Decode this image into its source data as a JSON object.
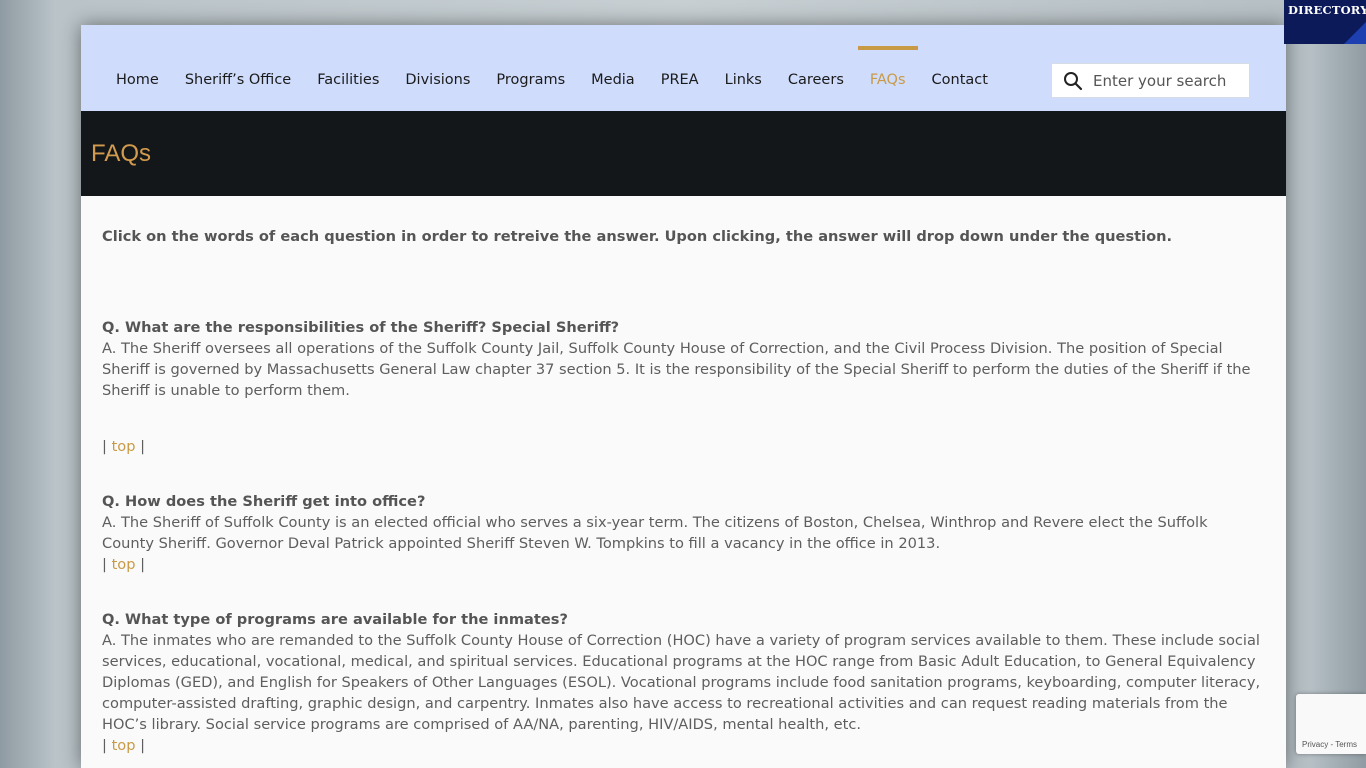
{
  "nav": {
    "items": [
      {
        "label": "Home"
      },
      {
        "label": "Sheriff’s Office"
      },
      {
        "label": "Facilities"
      },
      {
        "label": "Divisions"
      },
      {
        "label": "Programs"
      },
      {
        "label": "Media"
      },
      {
        "label": "PREA"
      },
      {
        "label": "Links"
      },
      {
        "label": "Careers"
      },
      {
        "label": "FAQs"
      },
      {
        "label": "Contact"
      }
    ],
    "active": "FAQs"
  },
  "search": {
    "placeholder": "Enter your search",
    "icon": "search-icon"
  },
  "page_title": "FAQs",
  "intro": "Click on the words of each question in order to retreive the answer. Upon clicking, the answer will drop down under the question.",
  "faqs": [
    {
      "question": "Q. What are the responsibilities of the Sheriff? Special Sheriff?",
      "answer": "A. The Sheriff oversees all operations of the Suffolk County Jail, Suffolk County House of Correction, and the Civil Process Division. The position of Special Sheriff is governed by Massachusetts General Law chapter 37 section 5. It is the responsibility of the Special Sheriff to perform the duties of the Sheriff if the Sheriff is unable to perform them.",
      "top_label": "top"
    },
    {
      "question": "Q. How does the Sheriff get into office?",
      "answer": "A. The Sheriff of Suffolk County is an elected official who serves a six-year term. The citizens of Boston, Chelsea, Winthrop and Revere elect the Suffolk County Sheriff. Governor Deval Patrick appointed Sheriff Steven W. Tompkins to fill a vacancy in the office in 2013.",
      "top_label": "top"
    },
    {
      "question": "Q. What type of programs are available for the inmates?",
      "answer": "A. The inmates who are remanded to the Suffolk County House of Correction (HOC) have a variety of program services available to them. These include social services, educational, vocational, medical, and spiritual services. Educational programs at the HOC range from Basic Adult Education, to General Equivalency Diplomas (GED), and English for Speakers of Other Languages (ESOL). Vocational programs include food sanitation programs, keyboarding, computer literacy, computer-assisted drafting, graphic design, and carpentry. Inmates also have access to recreational activities and can request reading materials from the HOC’s library. Social service programs are comprised of AA/NA, parenting, HIV/AIDS, mental health, etc.",
      "top_label": "top"
    }
  ],
  "directory_label": "DIRECTORY",
  "recaptcha": {
    "privacy": "Privacy",
    "sep": " - ",
    "terms": "Terms"
  },
  "colors": {
    "nav_bg": "#cfdcfc",
    "accent": "#c99a45",
    "title_bar_bg": "#14171a",
    "directory_bg": "#0c1a5a"
  }
}
